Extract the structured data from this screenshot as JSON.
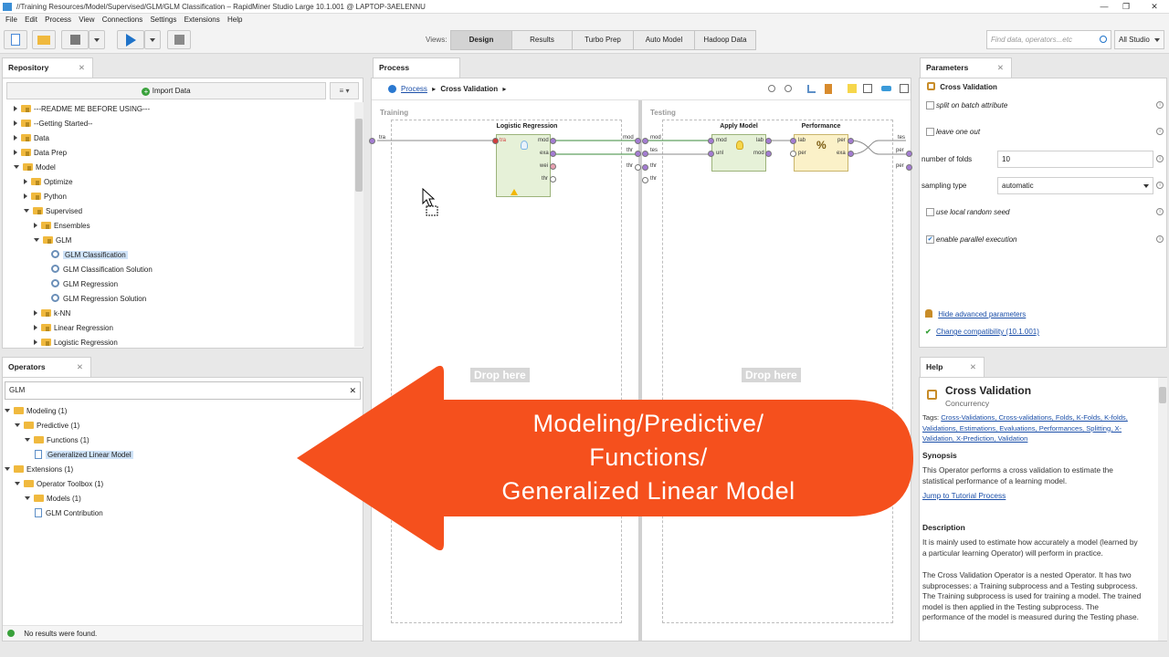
{
  "window": {
    "title": "//Training Resources/Model/Supervised/GLM/GLM Classification – RapidMiner Studio Large 10.1.001 @ LAPTOP-3AELENNU"
  },
  "menu": [
    "File",
    "Edit",
    "Process",
    "View",
    "Connections",
    "Settings",
    "Extensions",
    "Help"
  ],
  "toolbar": {
    "views_label": "Views:",
    "views": [
      "Design",
      "Results",
      "Turbo Prep",
      "Auto Model",
      "Hadoop Data"
    ],
    "search_placeholder": "Find data, operators...etc",
    "studio_dropdown": "All Studio"
  },
  "repository": {
    "tab": "Repository",
    "import_button": "Import Data",
    "items": [
      {
        "label": "---README ME BEFORE USING---",
        "indent": 1,
        "type": "folder",
        "arrow": "right"
      },
      {
        "label": "--Getting Started--",
        "indent": 1,
        "type": "folder",
        "arrow": "right"
      },
      {
        "label": "Data",
        "indent": 1,
        "type": "folder",
        "arrow": "right"
      },
      {
        "label": "Data Prep",
        "indent": 1,
        "type": "folder",
        "arrow": "right"
      },
      {
        "label": "Model",
        "indent": 1,
        "type": "folder",
        "arrow": "down"
      },
      {
        "label": "Optimize",
        "indent": 2,
        "type": "folder",
        "arrow": "right"
      },
      {
        "label": "Python",
        "indent": 2,
        "type": "folder",
        "arrow": "right"
      },
      {
        "label": "Supervised",
        "indent": 2,
        "type": "folder",
        "arrow": "down"
      },
      {
        "label": "Ensembles",
        "indent": 3,
        "type": "folder",
        "arrow": "right"
      },
      {
        "label": "GLM",
        "indent": 3,
        "type": "folder",
        "arrow": "down"
      },
      {
        "label": "GLM Classification",
        "indent": 4,
        "type": "process",
        "arrow": "none",
        "selected": true
      },
      {
        "label": "GLM Classification Solution",
        "indent": 4,
        "type": "process",
        "arrow": "none"
      },
      {
        "label": "GLM Regression",
        "indent": 4,
        "type": "process",
        "arrow": "none"
      },
      {
        "label": "GLM Regression Solution",
        "indent": 4,
        "type": "process",
        "arrow": "none"
      },
      {
        "label": "k-NN",
        "indent": 3,
        "type": "folder",
        "arrow": "right"
      },
      {
        "label": "Linear Regression",
        "indent": 3,
        "type": "folder",
        "arrow": "right"
      },
      {
        "label": "Logistic Regression",
        "indent": 3,
        "type": "folder",
        "arrow": "right"
      }
    ]
  },
  "operators": {
    "tab": "Operators",
    "search_value": "GLM",
    "tree": [
      {
        "label": "Modeling (1)",
        "indent": 0
      },
      {
        "label": "Predictive (1)",
        "indent": 1
      },
      {
        "label": "Functions (1)",
        "indent": 2
      },
      {
        "label": "Generalized Linear Model",
        "indent": 3,
        "selected": true,
        "leaf": true
      },
      {
        "label": "Extensions (1)",
        "indent": 0
      },
      {
        "label": "Operator Toolbox (1)",
        "indent": 1
      },
      {
        "label": "Models (1)",
        "indent": 2
      },
      {
        "label": "GLM Contribution",
        "indent": 3,
        "leaf": true
      }
    ],
    "status": "No results were found."
  },
  "process": {
    "tab": "Process",
    "breadcrumb_root": "Process",
    "breadcrumb_current": "Cross Validation",
    "training_label": "Training",
    "testing_label": "Testing",
    "drop_here": "Drop here",
    "operators": {
      "logistic": {
        "name": "Logistic Regression",
        "in": [
          "tra"
        ],
        "out": [
          "mod",
          "exa",
          "wei",
          "thr"
        ]
      },
      "apply": {
        "name": "Apply Model",
        "in": [
          "mod",
          "unl"
        ],
        "out": [
          "lab",
          "mod"
        ]
      },
      "performance": {
        "name": "Performance",
        "in": [
          "lab",
          "per"
        ],
        "out": [
          "per",
          "exa"
        ]
      }
    },
    "training_ports_left": [
      "tra"
    ],
    "training_ports_right": [
      "mod",
      "thr",
      "thr"
    ],
    "testing_ports_left": [
      "mod",
      "tes",
      "thr",
      "thr"
    ],
    "testing_ports_right": [
      "tes",
      "per",
      "per"
    ]
  },
  "parameters": {
    "tab": "Parameters",
    "operator": "Cross Validation",
    "rows": [
      {
        "label": "split on batch attribute",
        "type": "checkbox",
        "checked": false
      },
      {
        "label": "leave one out",
        "type": "checkbox",
        "checked": false
      },
      {
        "label": "number of folds",
        "type": "text",
        "value": "10"
      },
      {
        "label": "sampling type",
        "type": "select",
        "value": "automatic"
      },
      {
        "label": "use local random seed",
        "type": "checkbox",
        "checked": false
      },
      {
        "label": "enable parallel execution",
        "type": "checkbox",
        "checked": true
      }
    ],
    "hide_advanced": "Hide advanced parameters",
    "compatibility": "Change compatibility (10.1.001)"
  },
  "help": {
    "tab": "Help",
    "title": "Cross Validation",
    "subtitle": "Concurrency",
    "tags_prefix": "Tags:",
    "tags": "Cross-Validations, Cross-validations, Folds, K-Folds, K-folds, Validations, Estimations, Evaluations, Performances, Splitting, X-Validation, X-Prediction, Validation",
    "synopsis_h": "Synopsis",
    "synopsis": "This Operator performs a cross validation to estimate the statistical performance of a learning model.",
    "tutorial_link": "Jump to Tutorial Process",
    "description_h": "Description",
    "desc1": "It is mainly used to estimate how accurately a model (learned by a particular learning Operator) will perform in practice.",
    "desc2": "The Cross Validation Operator is a nested Operator. It has two subprocesses: a Training subprocess and a Testing subprocess. The Training subprocess is used for training a model. The trained model is then applied in the Testing subprocess. The performance of the model is measured during the Testing phase."
  },
  "callout": {
    "line1": "Modeling/Predictive/",
    "line2": "Functions/",
    "line3": "Generalized Linear Model",
    "color": "#f5501d"
  }
}
